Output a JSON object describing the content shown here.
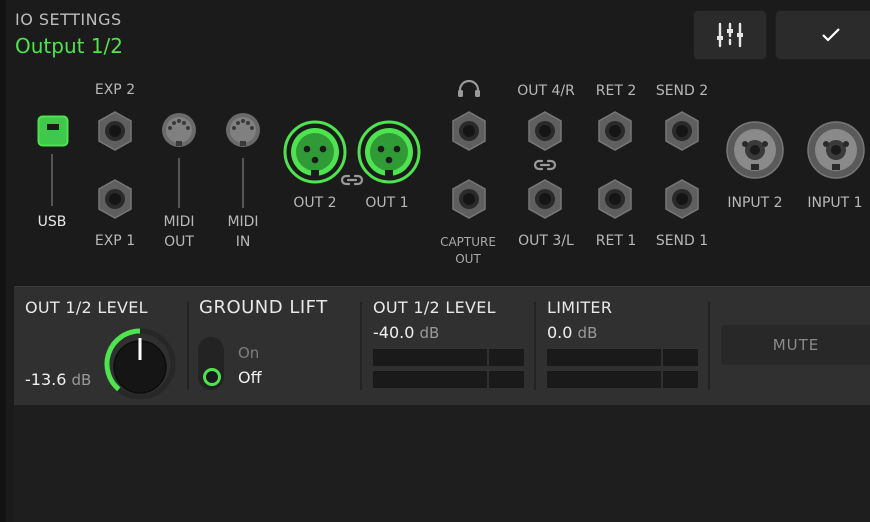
{
  "header": {
    "title": "IO SETTINGS",
    "subtitle": "Output 1/2",
    "mixer_icon": "mixer-sliders-icon",
    "confirm_icon": "checkmark-icon"
  },
  "io": {
    "usb": "USB",
    "exp2": "EXP 2",
    "exp1": "EXP 1",
    "midi_out_l1": "MIDI",
    "midi_out_l2": "OUT",
    "midi_in_l1": "MIDI",
    "midi_in_l2": "IN",
    "out2": "OUT 2",
    "out1": "OUT 1",
    "headphones_icon": "headphones-icon",
    "capture_l1": "CAPTURE",
    "capture_l2": "OUT",
    "out4r": "OUT 4/R",
    "out3l": "OUT 3/L",
    "ret2": "RET 2",
    "ret1": "RET 1",
    "send2": "SEND 2",
    "send1": "SEND 1",
    "input2": "INPUT 2",
    "input1": "INPUT 1"
  },
  "panel": {
    "level_title": "OUT 1/2 LEVEL",
    "level_value": "-13.6",
    "level_unit": "dB",
    "ground_title": "GROUND LIFT",
    "ground_on": "On",
    "ground_off": "Off",
    "meter_title": "OUT 1/2 LEVEL",
    "meter_value": "-40.0",
    "meter_unit": "dB",
    "limiter_title": "LIMITER",
    "limiter_value": "0.0",
    "limiter_unit": "dB",
    "mute": "MUTE"
  },
  "colors": {
    "accent": "#4ee34f",
    "background": "#1b1b1b",
    "panel": "#303030"
  }
}
